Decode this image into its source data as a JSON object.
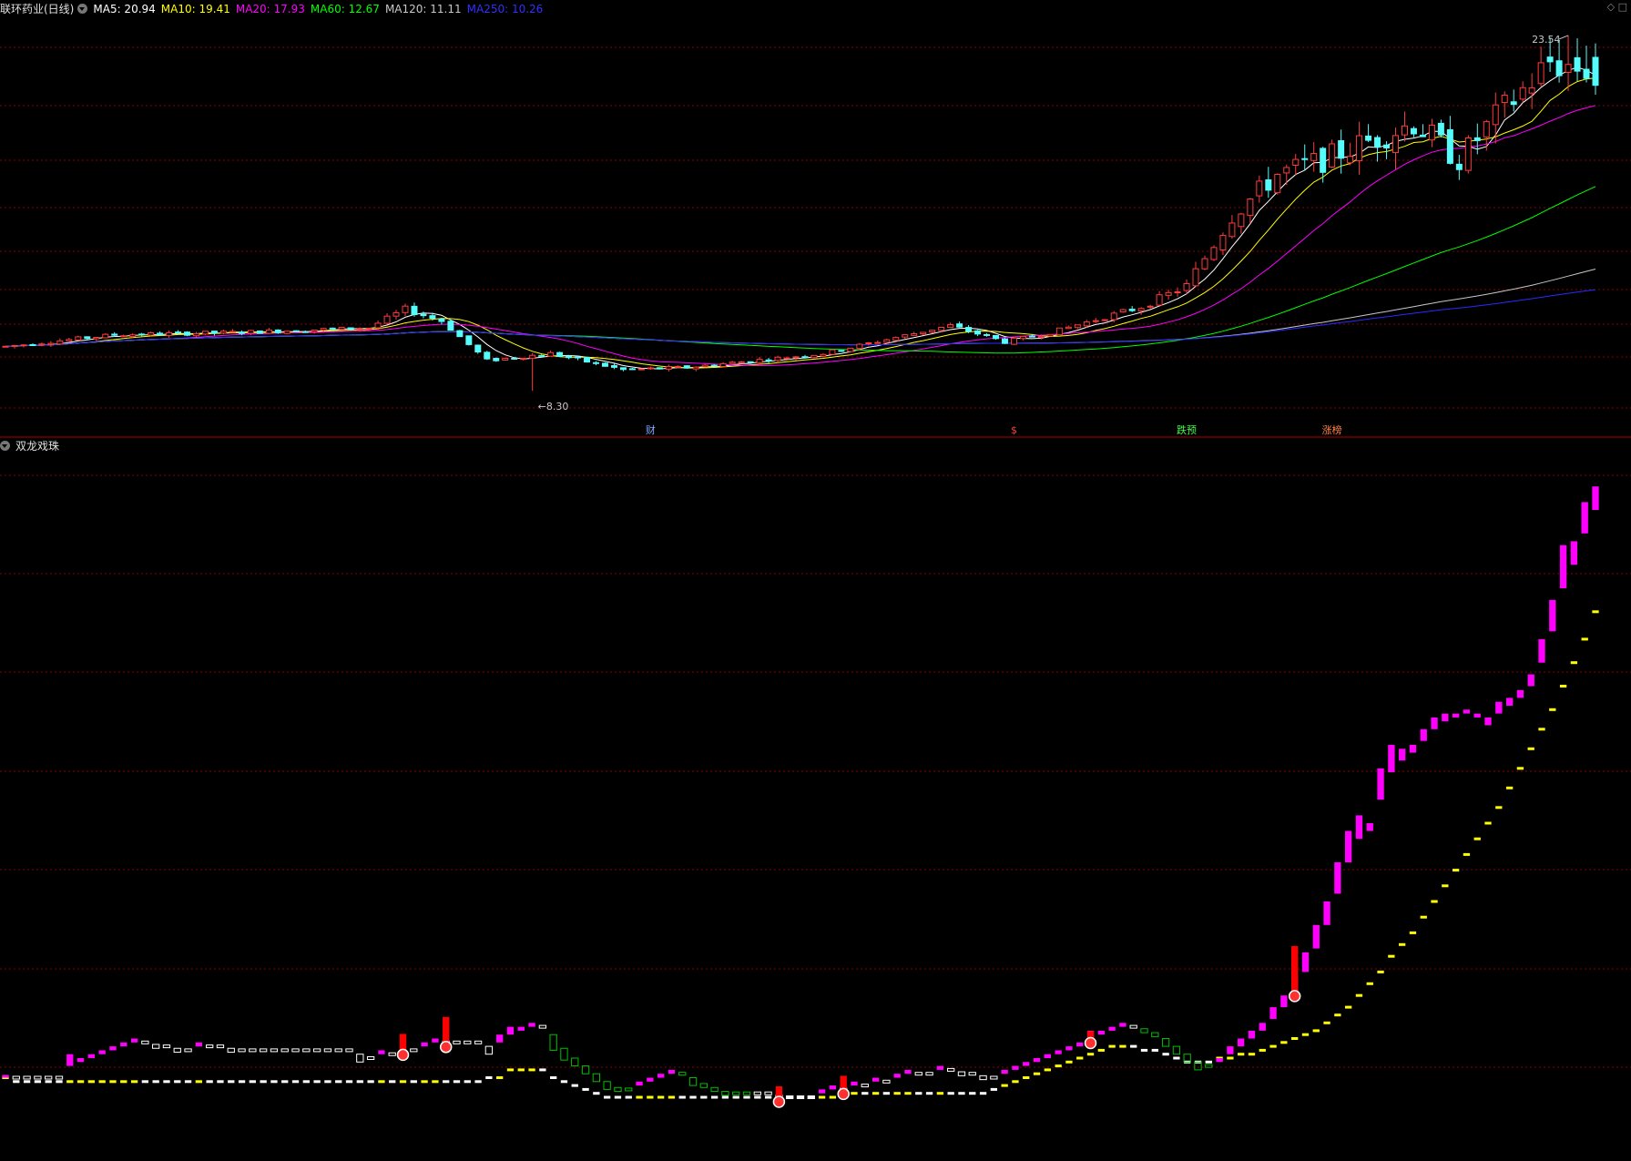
{
  "header": {
    "title": "联环药业(日线)",
    "ma": [
      {
        "label": "MA5: 20.94",
        "color": "#ffffff"
      },
      {
        "label": "MA10: 19.41",
        "color": "#ffff00"
      },
      {
        "label": "MA20: 17.93",
        "color": "#ff00ff"
      },
      {
        "label": "MA60: 12.67",
        "color": "#00ff00"
      },
      {
        "label": "MA120: 11.11",
        "color": "#c8c8c8"
      },
      {
        "label": "MA250: 10.26",
        "color": "#0000ff"
      }
    ],
    "corner_icons": [
      "diamond-icon",
      "square-icon"
    ]
  },
  "indicator": {
    "title": "双龙戏珠"
  },
  "colors": {
    "up": "#ff3c3c",
    "down": "#54fcfc",
    "grid": "#8b0000",
    "separator": "#b00000",
    "pink": "#ff00ff",
    "yellow": "#ffff00",
    "green": "#00c000",
    "white": "#ffffff"
  },
  "chart_data": [
    {
      "type": "candlestick",
      "ylim": [
        7.8,
        24.2
      ],
      "high_label": "23.54",
      "low_label": "8.30",
      "markers": [
        {
          "label": "财",
          "index": 71,
          "color": "#7fa8ff"
        },
        {
          "label": "$",
          "index": 111,
          "color": "#ff3c3c"
        },
        {
          "label": "跌预",
          "index": 130,
          "color": "#40ff40"
        },
        {
          "label": "涨榜",
          "index": 146,
          "color": "#ff8040"
        }
      ]
    },
    {
      "type": "indicator",
      "ylim": [
        0,
        100
      ],
      "pink": [
        5,
        5,
        5,
        5,
        5,
        5,
        8,
        9,
        10,
        11,
        12,
        13,
        14,
        14,
        13,
        13,
        12,
        12,
        13,
        13,
        13,
        12,
        12,
        12,
        12,
        12,
        12,
        12,
        12,
        12,
        12,
        12,
        12,
        10,
        10,
        11,
        11,
        12,
        12,
        13,
        14,
        14,
        14,
        14,
        14,
        12,
        14,
        16,
        17,
        18,
        18,
        14,
        11,
        9,
        7,
        5,
        3,
        2,
        2,
        3,
        4,
        5,
        6,
        6,
        4,
        3,
        2,
        1,
        1,
        1,
        1,
        1,
        0,
        0,
        0,
        0,
        1,
        2,
        2,
        3,
        3,
        4,
        4,
        5,
        6,
        6,
        6,
        7,
        7,
        6,
        6,
        5,
        5,
        6,
        7,
        8,
        9,
        10,
        11,
        12,
        13,
        15,
        16,
        17,
        18,
        18,
        17,
        16,
        14,
        12,
        10,
        8,
        8,
        9,
        11,
        13,
        15,
        17,
        20,
        23,
        27,
        32,
        38,
        44,
        52,
        60,
        66,
        68,
        76,
        83,
        86,
        88,
        91,
        94,
        96,
        97,
        98,
        97,
        95,
        98,
        100,
        102,
        105,
        111,
        119,
        130,
        136,
        144,
        150
      ],
      "yellow": [
        5,
        4,
        4,
        4,
        4,
        4,
        4,
        4,
        4,
        4,
        4,
        4,
        4,
        4,
        4,
        4,
        4,
        4,
        4,
        4,
        4,
        4,
        4,
        4,
        4,
        4,
        4,
        4,
        4,
        4,
        4,
        4,
        4,
        4,
        4,
        4,
        4,
        4,
        4,
        4,
        4,
        4,
        4,
        4,
        4,
        5,
        5,
        7,
        7,
        7,
        7,
        5,
        4,
        3,
        2,
        1,
        0,
        0,
        0,
        0,
        0,
        0,
        0,
        0,
        0,
        0,
        0,
        0,
        0,
        0,
        0,
        0,
        0,
        0,
        0,
        0,
        0,
        0,
        1,
        1,
        1,
        1,
        1,
        1,
        1,
        1,
        1,
        1,
        1,
        1,
        1,
        1,
        2,
        3,
        4,
        5,
        6,
        7,
        8,
        9,
        10,
        11,
        12,
        13,
        13,
        13,
        12,
        12,
        11,
        10,
        9,
        9,
        9,
        10,
        10,
        11,
        11,
        12,
        13,
        14,
        15,
        16,
        17,
        19,
        21,
        23,
        26,
        29,
        32,
        36,
        39,
        42,
        46,
        50,
        54,
        58,
        62,
        66,
        70,
        74,
        79,
        84,
        89,
        94,
        99,
        105,
        111,
        117,
        124
      ],
      "signals": [
        {
          "index": 37,
          "h": 18
        },
        {
          "index": 41,
          "h": 28
        },
        {
          "index": 72,
          "h": 12
        },
        {
          "index": 78,
          "h": 15
        },
        {
          "index": 101,
          "h": 8
        },
        {
          "index": 120,
          "h": 50
        }
      ]
    }
  ]
}
